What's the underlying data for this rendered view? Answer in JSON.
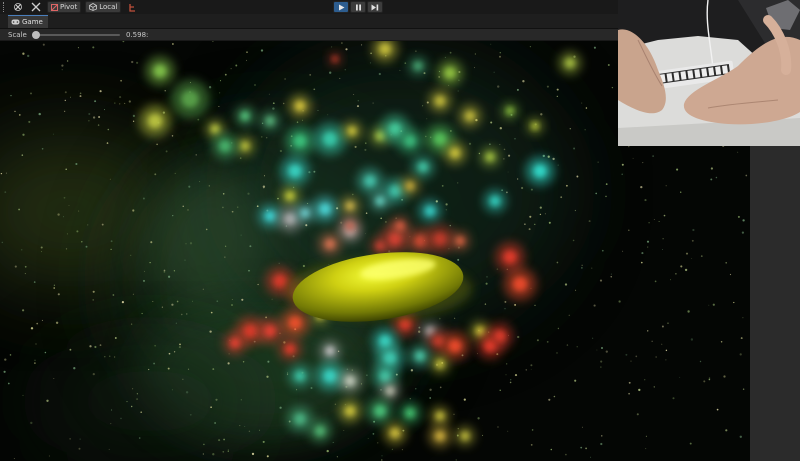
{
  "toolbar": {
    "pivot_label": "Pivot",
    "local_label": "Local",
    "icons": [
      "grip-icon",
      "hand-tool-icon",
      "move-tool-icon",
      "pivot-icon",
      "local-icon",
      "collab-icon"
    ],
    "play_controls": [
      "play-icon",
      "pause-icon",
      "step-icon"
    ]
  },
  "tab": {
    "label": "Game",
    "icon": "gamepad-icon"
  },
  "scale": {
    "label": "Scale",
    "value_text": "0.598:",
    "value": 0.05
  },
  "colors": {
    "accent_blue": "#2d5d8f",
    "toolbar_bg": "#191919",
    "viewport_bg": "#040604",
    "ellipsoid": "#c8c400"
  },
  "scene": {
    "description_icon": "galaxy-particles",
    "object": "yellow-ellipsoid"
  },
  "webcam": {
    "icon": "webcam-feed"
  }
}
